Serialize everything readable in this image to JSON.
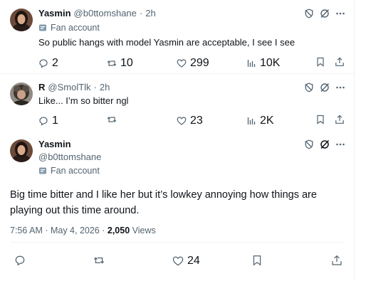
{
  "tweets": [
    {
      "name": "Yasmin",
      "handle": "@b0ttomshane",
      "dot": "·",
      "time": "2h",
      "fan_label": "Fan account",
      "text": "So public hangs with model Yasmin are acceptable, I see I see",
      "stats": {
        "replies": "2",
        "reposts": "10",
        "likes": "299",
        "views": "10K"
      }
    },
    {
      "name": "R",
      "handle": "@SmolTlk",
      "dot": "·",
      "time": "2h",
      "text": "Like... I’m so bitter ngl",
      "stats": {
        "replies": "1",
        "reposts": "",
        "likes": "23",
        "views": "2K"
      }
    },
    {
      "name": "Yasmin",
      "handle": "@b0ttomshane",
      "fan_label": "Fan account",
      "text": "Big time bitter and I like her but it’s lowkey annoying how things are playing out this time around.",
      "timestamp": "7:56 AM · May 4, 2026 · ",
      "view_count": "2,050",
      "views_label": " Views",
      "stats": {
        "likes": "24"
      }
    }
  ],
  "icons": {
    "block": "block-icon",
    "grok": "grok-icon",
    "more": "more-icon",
    "reply": "reply-icon",
    "repost": "repost-icon",
    "like": "like-icon",
    "views": "views-icon",
    "bookmark": "bookmark-icon",
    "share": "share-icon",
    "fan_badge": "fan-badge-icon"
  },
  "colors": {
    "text": "#0f1419",
    "muted": "#536471",
    "border": "#eff3f4",
    "badge": "#829aab"
  }
}
